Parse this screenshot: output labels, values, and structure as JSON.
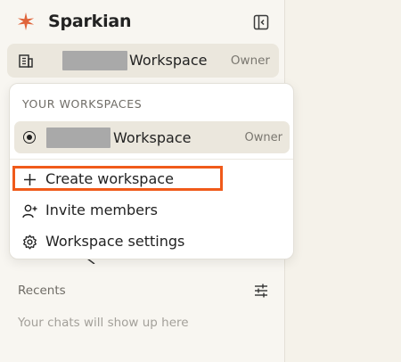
{
  "app": {
    "name": "Sparkian"
  },
  "colors": {
    "accent": "#e0643a",
    "highlight": "#f05a1a",
    "sidebar_bg": "#f8f6f1",
    "main_bg": "#f5f2ea"
  },
  "icons": {
    "brand": "sparkle-icon",
    "collapse": "sidebar-collapse-icon",
    "workspace": "building-icon",
    "create": "plus-icon",
    "invite": "add-user-icon",
    "settings": "gear-icon",
    "filter": "sliders-icon"
  },
  "workspace_trigger": {
    "name": "Workspace",
    "role": "Owner"
  },
  "dropdown": {
    "header": "YOUR WORKSPACES",
    "workspaces": [
      {
        "name": "Workspace",
        "role": "Owner",
        "selected": true
      }
    ],
    "actions": [
      {
        "label": "Create workspace"
      },
      {
        "label": "Invite members"
      },
      {
        "label": "Workspace settings"
      }
    ]
  },
  "recents": {
    "label": "Recents",
    "empty_text": "Your chats will show up here"
  }
}
